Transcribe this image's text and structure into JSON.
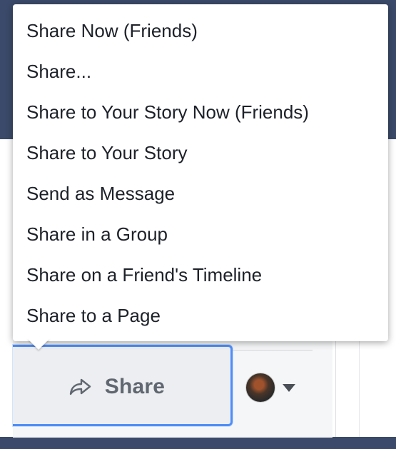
{
  "share_menu": {
    "items": [
      {
        "label": "Share Now (Friends)"
      },
      {
        "label": "Share..."
      },
      {
        "label": "Share to Your Story Now (Friends)"
      },
      {
        "label": "Share to Your Story"
      },
      {
        "label": "Send as Message"
      },
      {
        "label": "Share in a Group"
      },
      {
        "label": "Share on a Friend's Timeline"
      },
      {
        "label": "Share to a Page"
      }
    ]
  },
  "action_bar": {
    "share_label": "Share",
    "share_icon": "share-arrow-icon",
    "audience_icon": "avatar",
    "audience_caret_icon": "chevron-down-icon"
  },
  "colors": {
    "header_blue": "#3b4a6a",
    "focus_ring": "#4f8ef7",
    "menu_text": "#1d2129",
    "button_text": "#606770"
  }
}
